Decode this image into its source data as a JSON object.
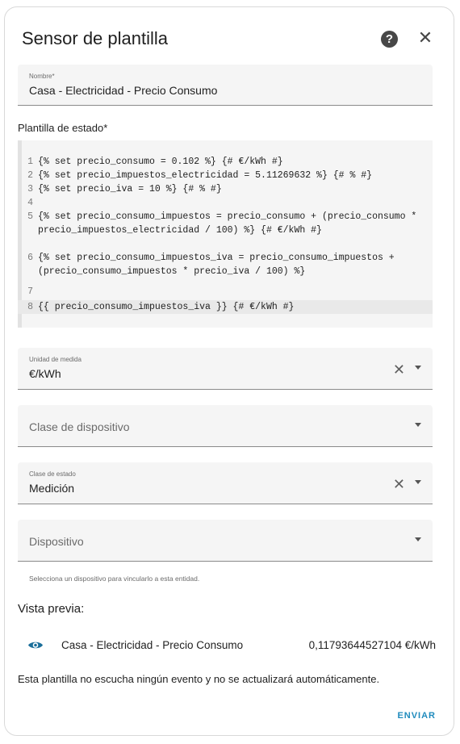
{
  "dialog": {
    "title": "Sensor de plantilla"
  },
  "name_field": {
    "label": "Nombre*",
    "value": "Casa - Electricidad - Precio Consumo"
  },
  "template": {
    "label": "Plantilla de estado*",
    "lines": [
      {
        "n": "1",
        "text": "{% set precio_consumo = 0.102 %} {# €/kWh #}"
      },
      {
        "n": "2",
        "text": "{% set precio_impuestos_electricidad = 5.11269632 %} {# % #}"
      },
      {
        "n": "3",
        "text": "{% set precio_iva = 10 %} {# % #}"
      },
      {
        "n": "4",
        "text": ""
      },
      {
        "n": "5",
        "text": "{% set precio_consumo_impuestos = precio_consumo + (precio_consumo * precio_impuestos_electricidad / 100) %} {# €/kWh #}"
      },
      {
        "n": "6",
        "text": "{% set precio_consumo_impuestos_iva = precio_consumo_impuestos + (precio_consumo_impuestos * precio_iva / 100) %}"
      },
      {
        "n": "7",
        "text": ""
      },
      {
        "n": "8",
        "text": "{{ precio_consumo_impuestos_iva }} {# €/kWh #}"
      }
    ]
  },
  "unit_field": {
    "label": "Unidad de medida",
    "value": "€/kWh"
  },
  "device_class_field": {
    "placeholder": "Clase de dispositivo"
  },
  "state_class_field": {
    "label": "Clase de estado",
    "value": "Medición"
  },
  "device_field": {
    "placeholder": "Dispositivo",
    "hint": "Selecciona un dispositivo para vincularlo a esta entidad."
  },
  "preview": {
    "title": "Vista previa:",
    "entity_name": "Casa - Electricidad - Precio Consumo",
    "state": "0,11793644527104 €/kWh",
    "note": "Esta plantilla no escucha ningún evento y no se actualizará automáticamente."
  },
  "actions": {
    "submit_label": "ENVIAR"
  },
  "icons": {
    "help": "help-circle-icon",
    "close": "close-icon",
    "clear": "clear-icon",
    "caret": "chevron-down-icon",
    "preview": "eye-icon"
  },
  "colors": {
    "accent": "#1f8bbd",
    "eye_icon": "#1a6e9a"
  }
}
